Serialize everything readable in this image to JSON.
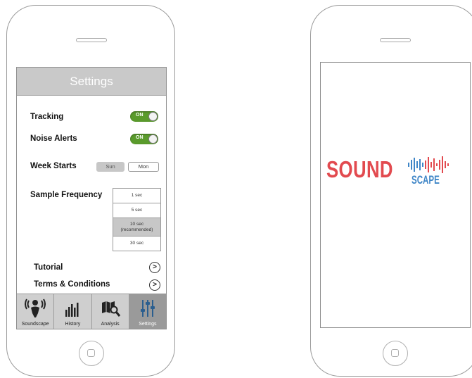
{
  "settings_screen": {
    "title": "Settings",
    "tracking": {
      "label": "Tracking",
      "toggle": "ON"
    },
    "noise_alerts": {
      "label": "Noise Alerts",
      "toggle": "ON"
    },
    "week_starts": {
      "label": "Week Starts",
      "options": [
        "Sun",
        "Mon"
      ],
      "selected": "Sun"
    },
    "sample_frequency": {
      "label": "Sample Frequency",
      "options": [
        "1 sec",
        "5 sec",
        "10 sec",
        "(recommended)",
        "30 sec"
      ],
      "selected": "10 sec"
    },
    "tutorial": {
      "label": "Tutorial",
      "chevron": ">"
    },
    "terms": {
      "label": "Terms & Conditions",
      "chevron": ">"
    },
    "tabs": [
      {
        "label": "Soundscape",
        "icon": "person-sound-icon"
      },
      {
        "label": "History",
        "icon": "bar-history-icon"
      },
      {
        "label": "Analysis",
        "icon": "map-magnifier-icon"
      },
      {
        "label": "Settings",
        "icon": "sliders-icon"
      }
    ],
    "active_tab": "Settings"
  },
  "splash_screen": {
    "logo_word_1": "SOUND",
    "logo_word_2": "SCAPE",
    "colors": {
      "sound": "#e24a4f",
      "scape": "#3f86c7",
      "waveform": [
        "#e24a4f",
        "#3f86c7"
      ]
    }
  },
  "colors": {
    "toggle_on": "#5a9b2c",
    "header": "#c9c9c9",
    "tab_active": "#9a9a9a"
  }
}
